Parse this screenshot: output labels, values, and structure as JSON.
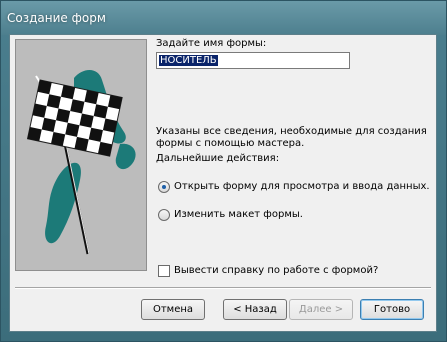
{
  "window": {
    "title": "Создание форм"
  },
  "form_name": {
    "prompt": "Задайте имя формы:",
    "value": "НОСИТЕЛЬ"
  },
  "info": {
    "line1": "Указаны все сведения, необходимые для создания",
    "line2": "формы с помощью мастера.",
    "next_actions": "Дальнейшие действия:"
  },
  "options": [
    {
      "label": "Открыть форму для просмотра и ввода данных.",
      "selected": true
    },
    {
      "label": "Изменить макет формы.",
      "selected": false
    }
  ],
  "help_checkbox": {
    "label": "Вывести справку по работе с формой?",
    "checked": false
  },
  "buttons": {
    "cancel": "Отмена",
    "back": "< Назад",
    "next": "Далее >",
    "finish": "Готово"
  },
  "colors": {
    "title_bar": "#4d7f8e",
    "art_background": "#bcbcbc",
    "brush_stroke": "#1c7a78",
    "selection": "#0a246a"
  },
  "icons": [
    "checkered-flag-icon"
  ]
}
